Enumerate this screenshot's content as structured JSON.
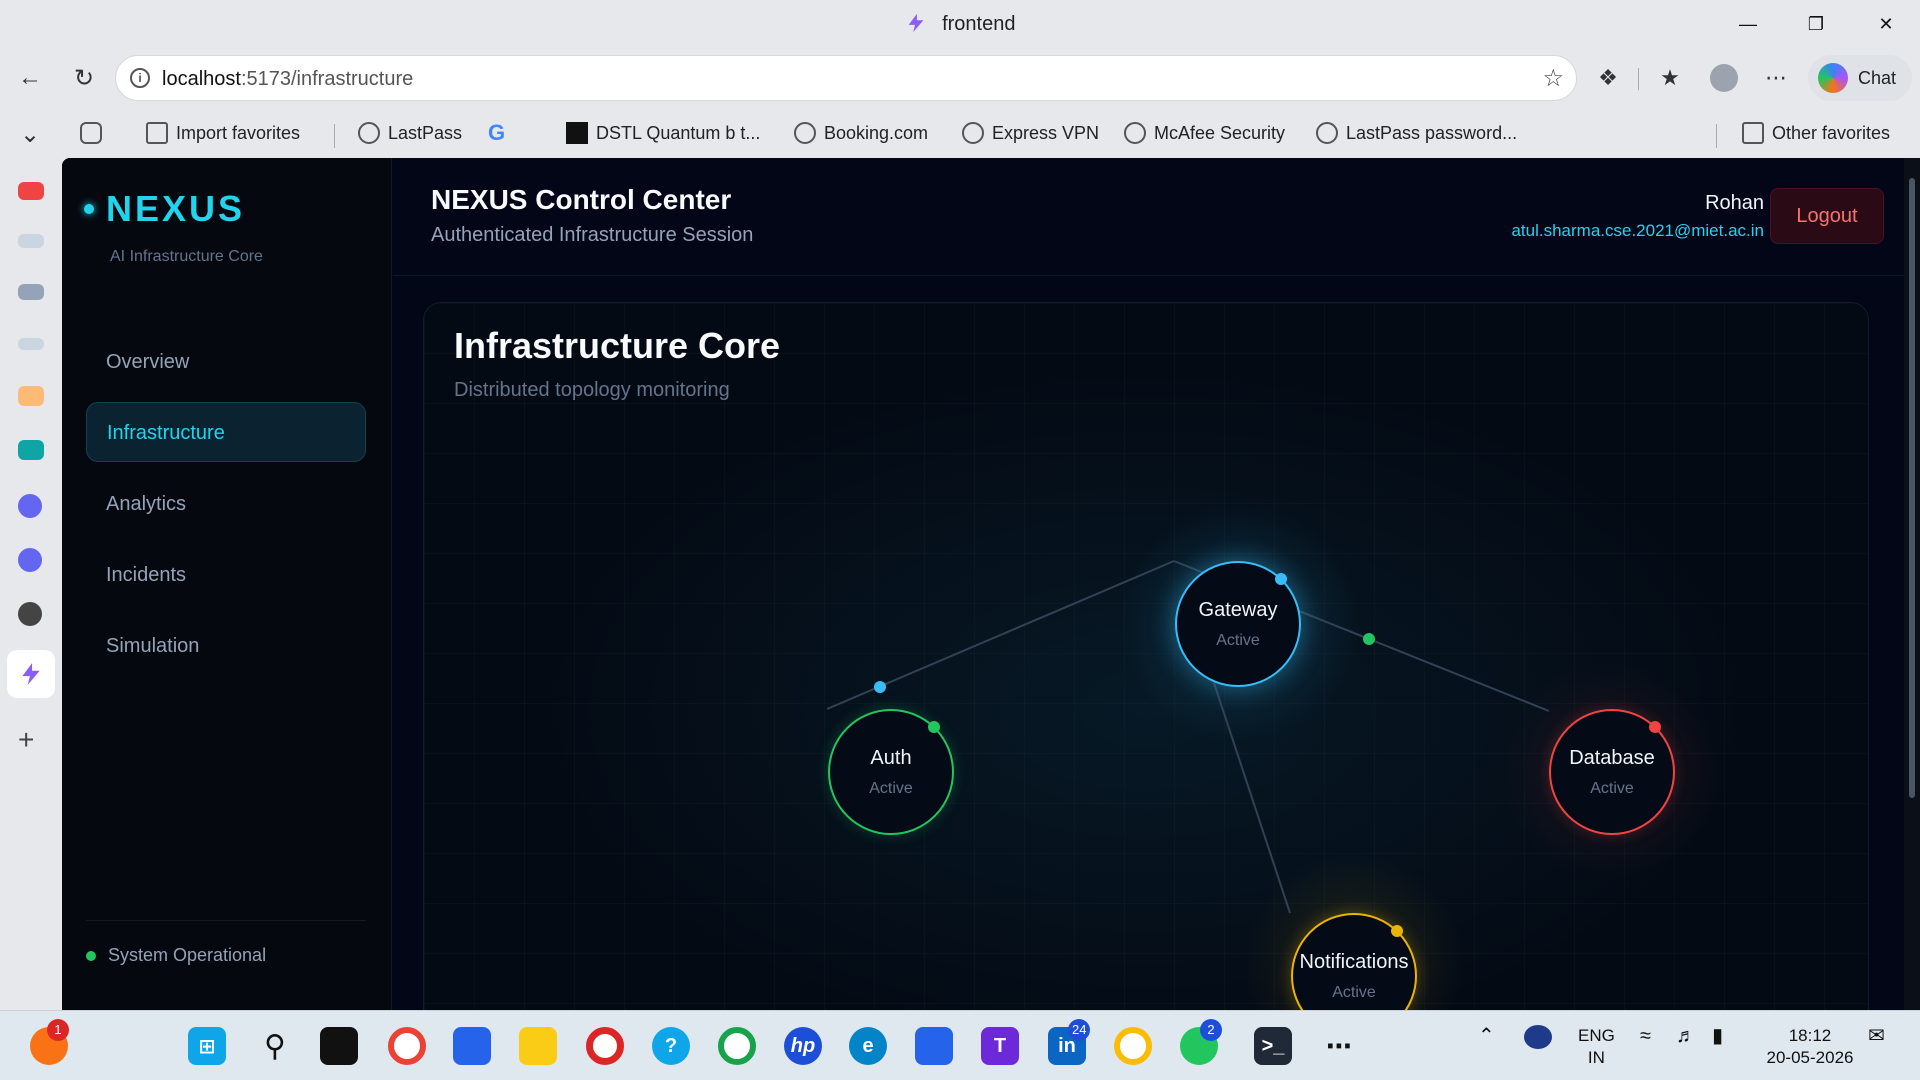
{
  "browser": {
    "tab_title": "frontend",
    "url_host": "localhost",
    "url_path": ":5173/infrastructure",
    "chat_label": "Chat",
    "favorites": [
      {
        "label": "Import favorites"
      },
      {
        "label": "LastPass"
      },
      {
        "label": "DSTL Quantum b t..."
      },
      {
        "label": "Booking.com"
      },
      {
        "label": "Express VPN"
      },
      {
        "label": "McAfee Security"
      },
      {
        "label": "LastPass password..."
      }
    ],
    "other_favorites": "Other favorites"
  },
  "app": {
    "brand": "NEXUS",
    "brand_sub": "AI Infrastructure Core",
    "nav": [
      {
        "label": "Overview",
        "active": false
      },
      {
        "label": "Infrastructure",
        "active": true
      },
      {
        "label": "Analytics",
        "active": false
      },
      {
        "label": "Incidents",
        "active": false
      },
      {
        "label": "Simulation",
        "active": false
      }
    ],
    "status": "System Operational",
    "header_title": "NEXUS Control Center",
    "header_subtitle": "Authenticated Infrastructure Session",
    "user_name": "Rohan",
    "user_email": "atul.sharma.cse.2021@miet.ac.in",
    "logout_label": "Logout",
    "card_title": "Infrastructure Core",
    "card_subtitle": "Distributed topology monitoring",
    "nodes": [
      {
        "name": "Gateway",
        "status": "Active",
        "color": "#38bdf8"
      },
      {
        "name": "Auth",
        "status": "Active",
        "color": "#22c55e"
      },
      {
        "name": "Database",
        "status": "Active",
        "color": "#ef4444"
      },
      {
        "name": "Notifications",
        "status": "Active",
        "color": "#eab308"
      }
    ]
  },
  "taskbar": {
    "notif_count": "1",
    "linkedin_badge": "24",
    "whatsapp_badge": "2",
    "lang": "ENG",
    "region": "IN",
    "time": "18:12",
    "date": "20-05-2026"
  }
}
